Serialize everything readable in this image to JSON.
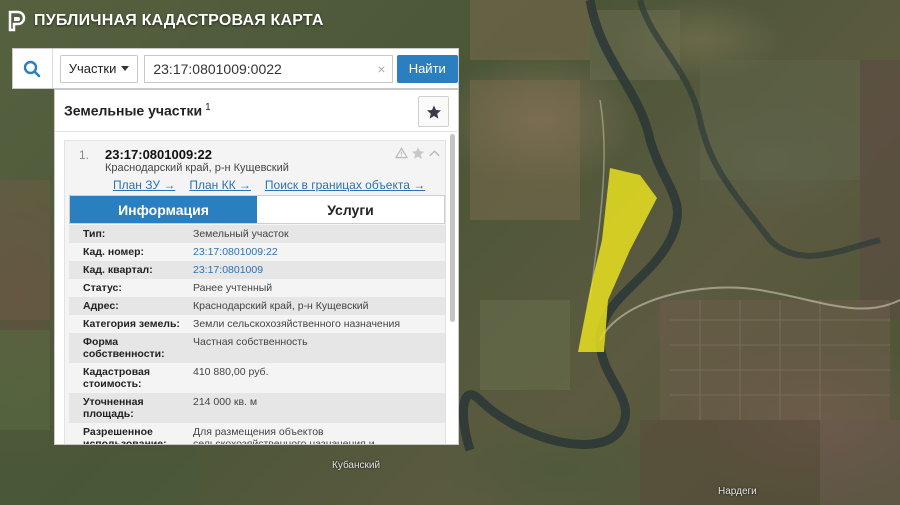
{
  "app": {
    "title": "ПУБЛИЧНАЯ КАДАСТРОВАЯ КАРТА"
  },
  "search": {
    "type_label": "Участки",
    "query": "23:17:0801009:0022",
    "find_label": "Найти",
    "clear_glyph": "×"
  },
  "panel": {
    "title": "Земельные участки",
    "count_sup": "1"
  },
  "result": {
    "index": "1.",
    "cad_number": "23:17:0801009:22",
    "address": "Краснодарский край, р-н Кущевский",
    "links": [
      "План ЗУ →",
      "План КК →",
      "Поиск в границах объекта →"
    ],
    "tabs": [
      "Информация",
      "Услуги"
    ],
    "properties": [
      {
        "key": "Тип:",
        "value": "Земельный участок"
      },
      {
        "key": "Кад. номер:",
        "value": "23:17:0801009:22"
      },
      {
        "key": "Кад. квартал:",
        "value": "23:17:0801009"
      },
      {
        "key": "Статус:",
        "value": "Ранее учтенный"
      },
      {
        "key": "Адрес:",
        "value": "Краснодарский край, р-н Кущевский"
      },
      {
        "key": "Категория земель:",
        "value": "Земли сельскохозяйственного назначения"
      },
      {
        "key": "Форма собственности:",
        "value": "Частная собственность"
      },
      {
        "key": "Кадастровая стоимость:",
        "value": "410 880,00 руб."
      },
      {
        "key": "Уточненная площадь:",
        "value": "214 000 кв. м"
      },
      {
        "key": "Разрешенное использование:",
        "value": "Для размещения объектов сельскохозяйственного назначения и"
      }
    ]
  },
  "map": {
    "labels": [
      "Кубанский",
      "Нардеги"
    ],
    "parcel_color": "#e8e020"
  },
  "colors": {
    "accent": "#2a7fc0",
    "link": "#2a72b5"
  }
}
